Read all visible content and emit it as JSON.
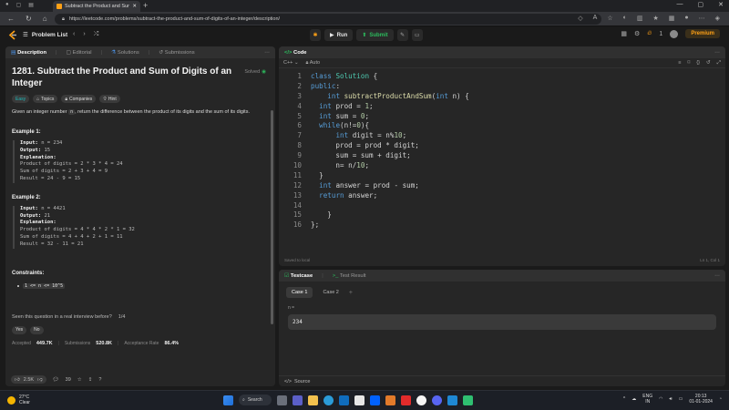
{
  "browser": {
    "tab_title": "Subtract the Product and Sum o",
    "url": "https://leetcode.com/problems/subtract-the-product-and-sum-of-digits-of-an-integer/description/"
  },
  "nav": {
    "problem_list": "Problem List",
    "run": "Run",
    "submit": "Submit",
    "streak": "1",
    "premium": "Premium"
  },
  "left_tabs": [
    "Description",
    "Editorial",
    "Solutions",
    "Submissions"
  ],
  "question": {
    "title": "1281. Subtract the Product and Sum of Digits of an Integer",
    "solved": "Solved",
    "tags": [
      "Easy",
      "Topics",
      "Companies",
      "Hint"
    ],
    "desc_before": "Given an integer number ",
    "desc_code": "n",
    "desc_after": ", return the difference between the product of its digits and the sum of its digits.",
    "examples": [
      {
        "head": "Example 1:",
        "input": "n = 234",
        "output": "15",
        "lines": [
          "Product of digits = 2 * 3 * 4 = 24",
          "Sum of digits = 2 + 3 + 4 = 9",
          "Result = 24 - 9 = 15"
        ]
      },
      {
        "head": "Example 2:",
        "input": "n = 4421",
        "output": "21",
        "lines": [
          "Product of digits = 4 * 4 * 2 * 1 = 32",
          "Sum of digits = 4 + 4 + 2 + 1 = 11",
          "Result = 32 - 11 = 21"
        ]
      }
    ],
    "labels": {
      "input": "Input:",
      "output": "Output:",
      "explanation": "Explanation:"
    },
    "constraints_head": "Constraints:",
    "constraint": "1 <= n <= 10^5",
    "interview_q": "Seen this question in a real interview before?",
    "interview_count": "1/4",
    "yes": "Yes",
    "no": "No",
    "accepted_label": "Accepted",
    "accepted": "449.7K",
    "submissions_label": "Submissions",
    "submissions": "520.8K",
    "rate_label": "Acceptance Rate",
    "rate": "86.4%",
    "likes": "2.5K",
    "comments": "39"
  },
  "editor": {
    "tab": "Code",
    "lang": "C++",
    "auto": "Auto",
    "saved": "Saved to local",
    "cursor": "Ln 1, Col 1",
    "lines": [
      "class Solution {",
      "public:",
      "    int subtractProductAndSum(int n) {",
      "  int prod = 1;",
      "  int sum = 0;",
      "  while(n!=0){",
      "      int digit = n%10;",
      "      prod = prod * digit;",
      "      sum = sum + digit;",
      "      n= n/10;",
      "  }",
      "  int answer = prod - sum;",
      "  return answer;",
      "",
      "    }",
      "};"
    ]
  },
  "testcase": {
    "tab1": "Testcase",
    "tab2": "Test Result",
    "case1": "Case 1",
    "case2": "Case 2",
    "var": "n =",
    "value": "234",
    "source": "Source"
  },
  "taskbar": {
    "temp": "27°C",
    "weather": "Clear",
    "search": "Search",
    "lang1": "ENG",
    "lang2": "IN",
    "time": "20:13",
    "date": "01-01-2024"
  }
}
